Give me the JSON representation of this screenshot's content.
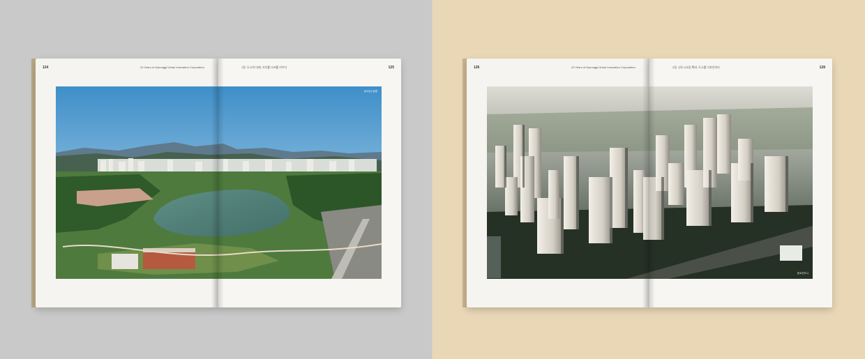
{
  "spread_left": {
    "page_left_number": "124",
    "page_right_number": "125",
    "running_head_left": "20 Years of Gyeonggi Urban Innovation Corporation",
    "running_head_right": "1장. 도시의 미래, 가치를 나라를 키우다",
    "photo_credit": "광교호수공원",
    "photo_subject": "lake-park-aerial"
  },
  "spread_right": {
    "page_left_number": "126",
    "page_right_number": "128",
    "running_head_left": "20 Years of Gyeonggi Urban Innovation Corporation",
    "running_head_right": "2장. 신도시사업 확대, 도시를 디자인하다",
    "photo_credit": "광교신도시",
    "photo_subject": "high-rise-apartment-complex-aerial"
  },
  "colors": {
    "left_background": "#c9c9c9",
    "right_background": "#e9d7b6",
    "page_paper": "#f5f4f1"
  }
}
